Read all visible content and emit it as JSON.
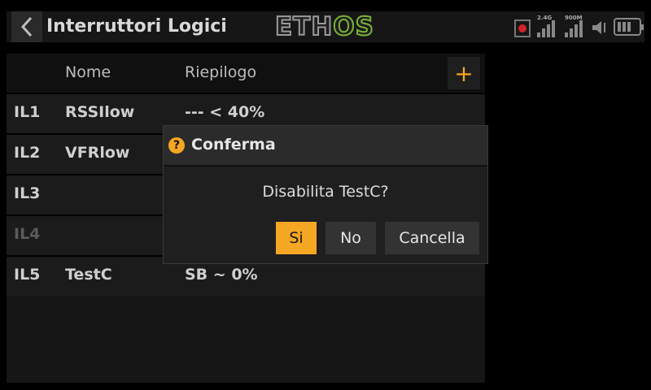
{
  "header": {
    "title": "Interruttori Logici",
    "logo_left": "ETH",
    "logo_right": "OS",
    "status": {
      "signal_a_label": "2.4G",
      "signal_b_label": "900M"
    }
  },
  "table": {
    "columns": [
      "Nome",
      "Riepilogo"
    ],
    "add_label": "+",
    "rows": [
      {
        "id": "IL1",
        "name": "RSSIlow",
        "summary": "--- < 40%",
        "disabled": false
      },
      {
        "id": "IL2",
        "name": "VFRlow",
        "summary": "",
        "disabled": false
      },
      {
        "id": "IL3",
        "name": "",
        "summary": "",
        "disabled": false
      },
      {
        "id": "IL4",
        "name": "",
        "summary": "",
        "disabled": true
      },
      {
        "id": "IL5",
        "name": "TestC",
        "summary": "SB ~ 0%",
        "disabled": false
      }
    ]
  },
  "dialog": {
    "icon": "?",
    "title": "Conferma",
    "message": "Disabilita TestC?",
    "buttons": {
      "yes": "Si",
      "no": "No",
      "cancel": "Cancella"
    }
  },
  "colors": {
    "accent": "#f5a623",
    "logo_green": "#7ab33a",
    "record_red": "#d2232a"
  }
}
